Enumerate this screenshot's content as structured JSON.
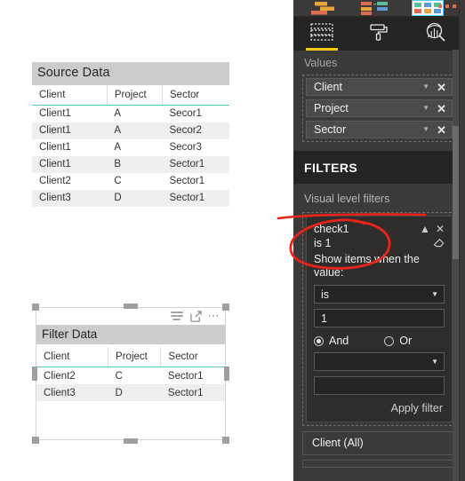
{
  "canvas": {
    "source_visual": {
      "title": "Source Data",
      "columns": [
        "Client",
        "Project",
        "Sector"
      ],
      "rows": [
        [
          "Client1",
          "A",
          "Secor1"
        ],
        [
          "Client1",
          "A",
          "Secor2"
        ],
        [
          "Client1",
          "A",
          "Secor3"
        ],
        [
          "Client1",
          "B",
          "Sector1"
        ],
        [
          "Client2",
          "C",
          "Sector1"
        ],
        [
          "Client3",
          "D",
          "Sector1"
        ]
      ]
    },
    "filter_visual": {
      "title": "Filter  Data",
      "columns": [
        "Client",
        "Project",
        "Sector"
      ],
      "rows": [
        [
          "Client2",
          "C",
          "Sector1"
        ],
        [
          "Client3",
          "D",
          "Sector1"
        ]
      ],
      "header_icons": [
        "filter-lines-icon",
        "focus-mode-icon",
        "more-options-icon"
      ]
    }
  },
  "panel": {
    "gallery": {
      "icons": [
        "stacked-bar-chart-icon",
        "decomposition-tree-icon",
        "matrix-table-icon"
      ],
      "more_label": "•••"
    },
    "tabs": [
      {
        "name": "fields-tab",
        "icon": "fields-grid-icon",
        "active": true
      },
      {
        "name": "format-tab",
        "icon": "paint-roller-icon",
        "active": false
      },
      {
        "name": "analytics-tab",
        "icon": "analytics-magnifier-icon",
        "active": false
      }
    ],
    "values": {
      "heading": "Values",
      "fields": [
        {
          "label": "Client"
        },
        {
          "label": "Project"
        },
        {
          "label": "Sector"
        }
      ]
    },
    "filters": {
      "heading": "FILTERS",
      "subheading": "Visual level filters",
      "card": {
        "field_name": "check1",
        "summary": "is 1",
        "collapse_icon": "chevron-up-icon",
        "remove_icon": "close-icon",
        "clear_icon": "eraser-icon",
        "instruction": "Show items when the value:",
        "operator_1": "is",
        "value_1": "1",
        "conjunction_and": "And",
        "conjunction_or": "Or",
        "conjunction_selected": "And",
        "operator_2": "",
        "value_2": "",
        "apply_label": "Apply filter"
      },
      "page_filters": [
        {
          "label": "Client  (All)"
        }
      ]
    }
  },
  "annotation": {
    "shapes": [
      "underline-stroke",
      "ellipse-highlight"
    ],
    "color": "#e8241c",
    "targets": [
      "check1",
      "is 1"
    ]
  }
}
